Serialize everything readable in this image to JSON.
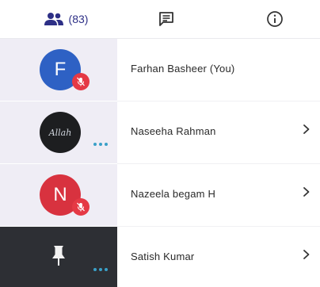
{
  "header": {
    "participants_count": "(83)",
    "icons": {
      "people": "people-icon",
      "chat": "chat-icon",
      "info": "info-icon"
    },
    "accent_color": "#2d2f86"
  },
  "participants": [
    {
      "initial": "F",
      "name": "Farhan Basheer (You)",
      "avatar_color": "#2e61c4",
      "muted": true,
      "has_more": false,
      "has_chevron": false
    },
    {
      "initial": "Allah",
      "name": "Naseeha Rahman",
      "avatar_color": "#1d1e20",
      "muted": false,
      "has_more": true,
      "has_chevron": true
    },
    {
      "initial": "N",
      "name": "Nazeela begam H",
      "avatar_color": "#d8323f",
      "muted": true,
      "has_more": false,
      "has_chevron": true
    },
    {
      "initial": "",
      "name": "Satish Kumar",
      "avatar_color": "#2d2f34",
      "muted": false,
      "has_more": true,
      "has_chevron": true,
      "pinned": true
    }
  ]
}
